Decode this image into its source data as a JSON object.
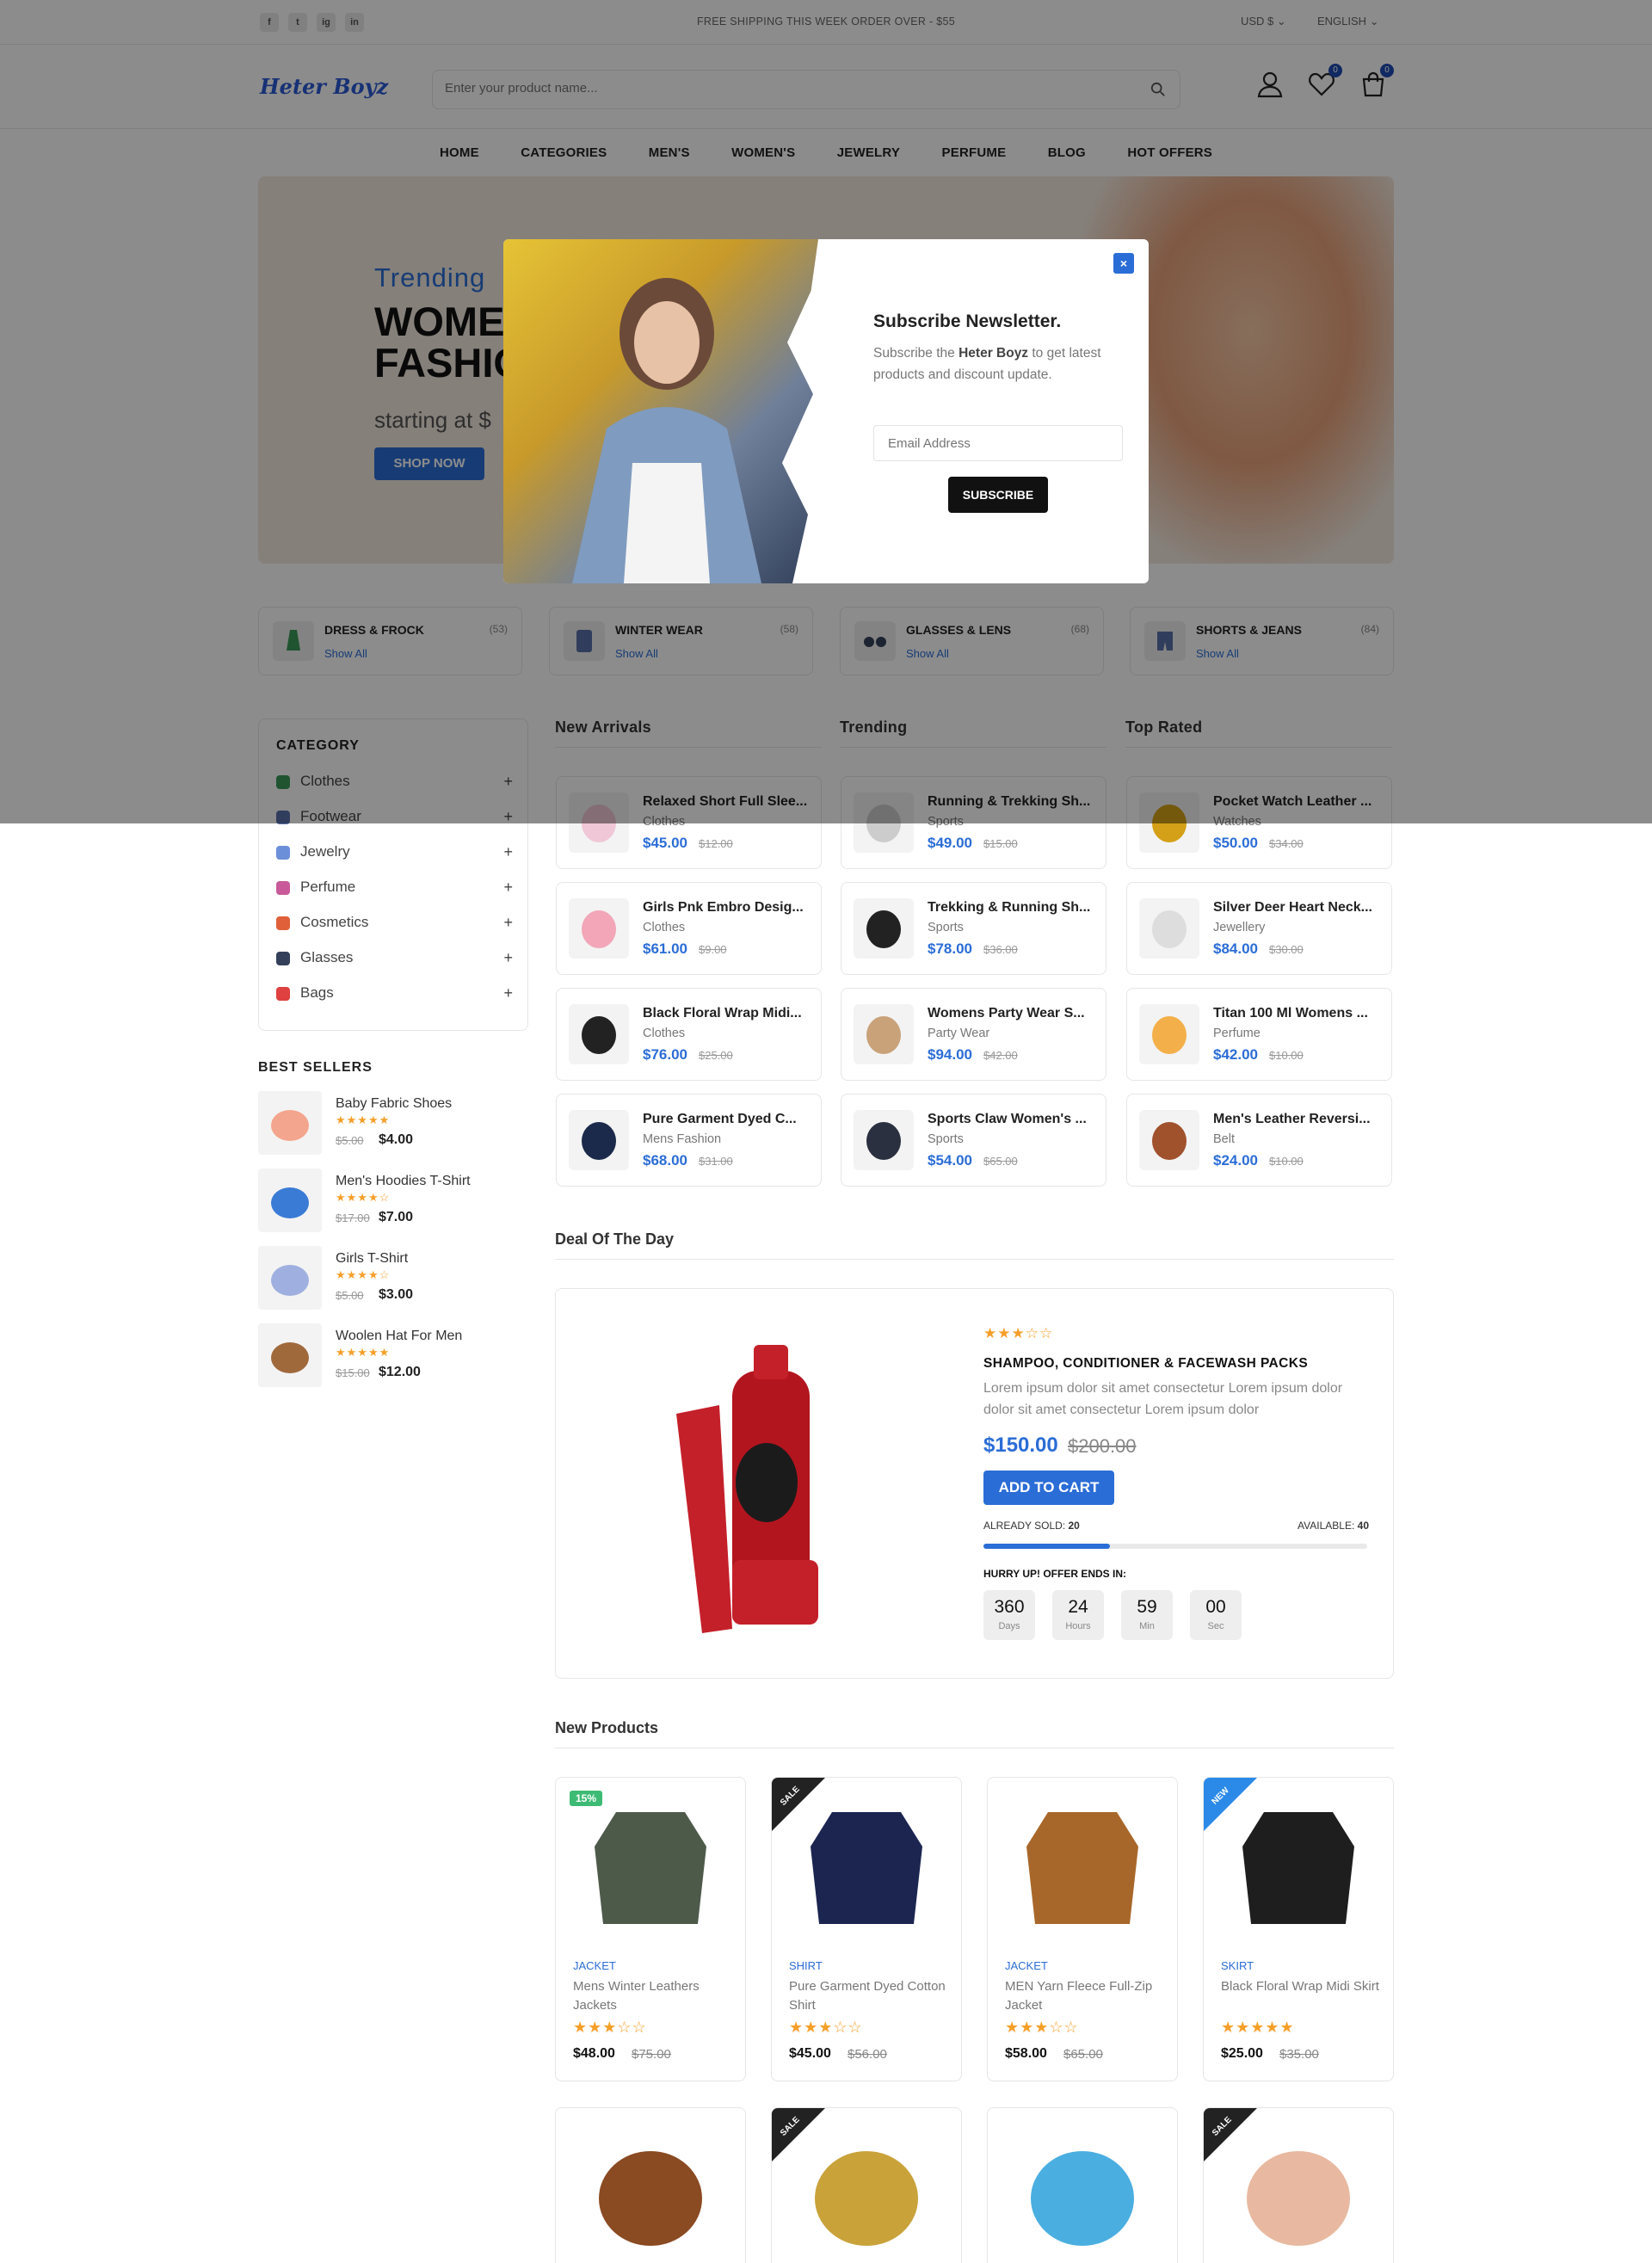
{
  "topbar": {
    "social": [
      "f",
      "t",
      "ig",
      "in"
    ],
    "shipping": "FREE SHIPPING THIS WEEK ORDER OVER - $55",
    "currency": "USD $",
    "language": "ENGLISH"
  },
  "header": {
    "logo": "Heter Boyz",
    "search_placeholder": "Enter your product name...",
    "wishlist_count": "0",
    "cart_count": "0"
  },
  "nav": [
    "HOME",
    "CATEGORIES",
    "MEN'S",
    "WOMEN'S",
    "JEWELRY",
    "PERFUME",
    "BLOG",
    "HOT OFFERS"
  ],
  "hero": {
    "subtitle": "Trending",
    "title_line1": "WOME",
    "title_line2": "FASHIO",
    "starting": "starting at $",
    "button": "SHOP NOW"
  },
  "categories": [
    {
      "name": "DRESS & FROCK",
      "count": "(53)",
      "link": "Show All"
    },
    {
      "name": "WINTER WEAR",
      "count": "(58)",
      "link": "Show All"
    },
    {
      "name": "GLASSES & LENS",
      "count": "(68)",
      "link": "Show All"
    },
    {
      "name": "SHORTS & JEANS",
      "count": "(84)",
      "link": "Show All"
    }
  ],
  "sidebar": {
    "title": "CATEGORY",
    "items": [
      "Clothes",
      "Footwear",
      "Jewelry",
      "Perfume",
      "Cosmetics",
      "Glasses",
      "Bags"
    ],
    "colors": [
      "#3b9a5a",
      "#5a6fa8",
      "#6b8fd8",
      "#c85a9a",
      "#e0603a",
      "#34405a",
      "#e04040"
    ]
  },
  "best": {
    "title": "BEST SELLERS",
    "items": [
      {
        "name": "Baby Fabric Shoes",
        "stars": "★★★★★",
        "old": "$5.00",
        "price": "$4.00"
      },
      {
        "name": "Men's Hoodies T-Shirt",
        "stars": "★★★★☆",
        "old": "$17.00",
        "price": "$7.00"
      },
      {
        "name": "Girls T-Shirt",
        "stars": "★★★★☆",
        "old": "$5.00",
        "price": "$3.00"
      },
      {
        "name": "Woolen Hat For Men",
        "stars": "★★★★★",
        "old": "$15.00",
        "price": "$12.00"
      }
    ]
  },
  "columns": [
    {
      "title": "New Arrivals",
      "items": [
        {
          "name": "Relaxed Short Full Slee...",
          "cat": "Clothes",
          "price": "$45.00",
          "old": "$12.00"
        },
        {
          "name": "Girls Pnk Embro Desig...",
          "cat": "Clothes",
          "price": "$61.00",
          "old": "$9.00"
        },
        {
          "name": "Black Floral Wrap Midi...",
          "cat": "Clothes",
          "price": "$76.00",
          "old": "$25.00"
        },
        {
          "name": "Pure Garment Dyed C...",
          "cat": "Mens Fashion",
          "price": "$68.00",
          "old": "$31.00"
        }
      ]
    },
    {
      "title": "Trending",
      "items": [
        {
          "name": "Running & Trekking Sh...",
          "cat": "Sports",
          "price": "$49.00",
          "old": "$15.00"
        },
        {
          "name": "Trekking & Running Sh...",
          "cat": "Sports",
          "price": "$78.00",
          "old": "$36.00"
        },
        {
          "name": "Womens Party Wear S...",
          "cat": "Party Wear",
          "price": "$94.00",
          "old": "$42.00"
        },
        {
          "name": "Sports Claw Women's ...",
          "cat": "Sports",
          "price": "$54.00",
          "old": "$65.00"
        }
      ]
    },
    {
      "title": "Top Rated",
      "items": [
        {
          "name": "Pocket Watch Leather ...",
          "cat": "Watches",
          "price": "$50.00",
          "old": "$34.00"
        },
        {
          "name": "Silver Deer Heart Neck...",
          "cat": "Jewellery",
          "price": "$84.00",
          "old": "$30.00"
        },
        {
          "name": "Titan 100 Ml Womens ...",
          "cat": "Perfume",
          "price": "$42.00",
          "old": "$10.00"
        },
        {
          "name": "Men's Leather Reversi...",
          "cat": "Belt",
          "price": "$24.00",
          "old": "$10.00"
        }
      ]
    }
  ],
  "deal": {
    "heading": "Deal Of The Day",
    "stars": "★★★☆☆",
    "title": "SHAMPOO, CONDITIONER & FACEWASH PACKS",
    "desc": "Lorem ipsum dolor sit amet consectetur Lorem ipsum dolor dolor sit amet consectetur Lorem ipsum dolor",
    "price": "$150.00",
    "old": "$200.00",
    "button": "ADD TO CART",
    "sold_label": "ALREADY SOLD:",
    "sold": "20",
    "avail_label": "AVAILABLE:",
    "avail": "40",
    "sold_fraction": 0.33,
    "hurry": "HURRY UP! OFFER ENDS IN:",
    "countdown": [
      {
        "v": "360",
        "l": "Days"
      },
      {
        "v": "24",
        "l": "Hours"
      },
      {
        "v": "59",
        "l": "Min"
      },
      {
        "v": "00",
        "l": "Sec"
      }
    ]
  },
  "newproducts": {
    "heading": "New Products",
    "items": [
      {
        "badge": "15%",
        "cat": "JACKET",
        "name": "Mens Winter Leathers Jackets",
        "stars": "★★★☆☆",
        "price": "$48.00",
        "old": "$75.00"
      },
      {
        "badge": "SALE",
        "cat": "SHIRT",
        "name": "Pure Garment Dyed Cotton Shirt",
        "stars": "★★★☆☆",
        "price": "$45.00",
        "old": "$56.00"
      },
      {
        "badge": "",
        "cat": "JACKET",
        "name": "MEN Yarn Fleece Full-Zip Jacket",
        "stars": "★★★☆☆",
        "price": "$58.00",
        "old": "$65.00"
      },
      {
        "badge": "NEW",
        "cat": "SKIRT",
        "name": "Black Floral Wrap Midi Skirt",
        "stars": "★★★★★",
        "price": "$25.00",
        "old": "$35.00"
      }
    ],
    "row2_badges": [
      "",
      "SALE",
      "",
      "SALE"
    ]
  },
  "modal": {
    "title": "Subscribe Newsletter.",
    "text_before": "Subscribe the ",
    "brand": "Heter Boyz",
    "text_after": " to get latest products and discount update.",
    "email_placeholder": "Email Address",
    "button": "SUBSCRIBE",
    "close": "×"
  }
}
